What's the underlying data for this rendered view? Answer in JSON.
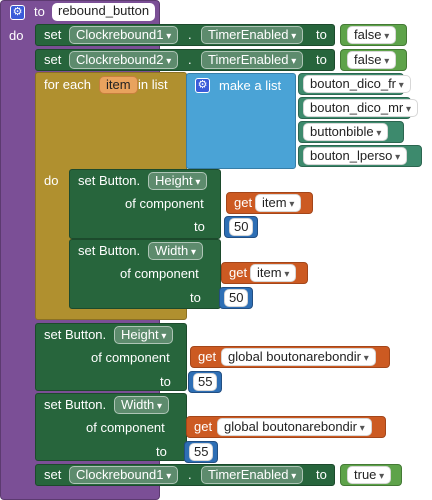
{
  "procedure": {
    "to_label": "to",
    "name": "rebound_button",
    "do_label": "do"
  },
  "kw": {
    "set": "set",
    "to": "to",
    "dot": ".",
    "for_each": "for each",
    "in_list": "in list",
    "do": "do",
    "make_a_list": "make a list",
    "of_component": "of component",
    "get": "get"
  },
  "stmt1": {
    "component": "Clockrebound1",
    "property": "TimerEnabled",
    "value": "false"
  },
  "stmt2": {
    "component": "Clockrebound2",
    "property": "TimerEnabled",
    "value": "false"
  },
  "loop": {
    "var": "item",
    "list_items": [
      "bouton_dico_fr",
      "bouton_dico_mr",
      "buttonbible",
      "bouton_lperso"
    ]
  },
  "inner1": {
    "label": "set Button.",
    "property": "Height",
    "var": "item",
    "value": "50"
  },
  "inner2": {
    "label": "set Button.",
    "property": "Width",
    "var": "item",
    "value": "50"
  },
  "outer1": {
    "label": "set Button.",
    "property": "Height",
    "var": "global boutonarebondir",
    "value": "55"
  },
  "outer2": {
    "label": "set Button.",
    "property": "Width",
    "var": "global boutonarebondir",
    "value": "55"
  },
  "stmt_last": {
    "component": "Clockrebound1",
    "property": "TimerEnabled",
    "value": "true"
  },
  "colors": {
    "procedure": "#7b4f96",
    "component_set": "#27653c",
    "for_each": "#b0902f",
    "list": "#4aa3d6",
    "get": "#cc5a22",
    "logic": "#5ea34a",
    "number": "#2e6fb5"
  },
  "icons": {
    "mutator": "gear-icon"
  }
}
